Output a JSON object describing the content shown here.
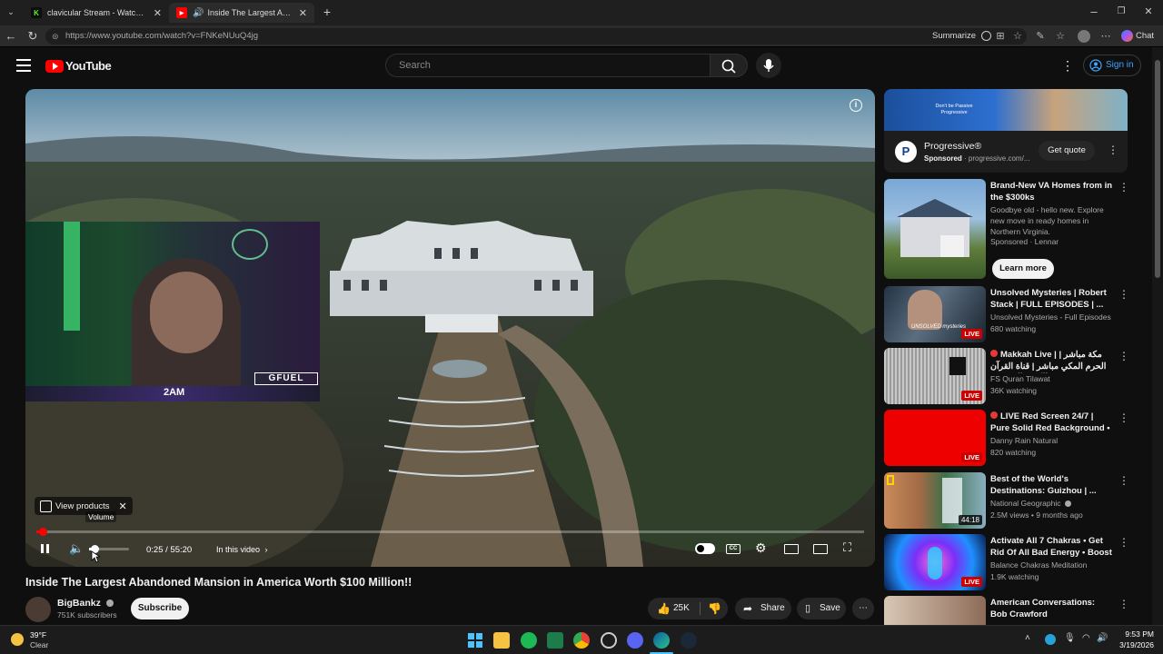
{
  "browser": {
    "tabs": [
      {
        "label": "clavicular Stream - Watch Live on Kick"
      },
      {
        "label": "Inside The Largest Abandoned Mansion"
      }
    ],
    "url": "https://www.youtube.com/watch?v=FNKeNUuQ4jg",
    "summarize_label": "Summarize",
    "chat_label": "Chat"
  },
  "header": {
    "logo": "YouTube",
    "search_placeholder": "Search",
    "signin_label": "Sign in"
  },
  "player": {
    "overlay_badge": "2AM",
    "overlay_brand": "GFUEL",
    "view_products_label": "View products",
    "volume_tooltip": "Volume",
    "time": "0:25 / 55:20",
    "in_this_video": "In this video",
    "progress_fraction": 0.0075
  },
  "video": {
    "title": "Inside The Largest Abandoned Mansion in America Worth $100 Million!!",
    "channel": "BigBankz",
    "subscribers": "751K subscribers",
    "subscribe_label": "Subscribe",
    "likes": "25K",
    "share_label": "Share",
    "save_label": "Save"
  },
  "ad": {
    "banner_text": "Don't be Passive Progressive",
    "name": "Progressive®",
    "sponsored": "Sponsored",
    "domain": "progressive.com/...",
    "cta": "Get quote"
  },
  "recommendations": [
    {
      "title": "Brand-New VA Homes from in the $300ks",
      "line1": "Goodbye old - hello new. Explore new move in ready homes in Northern Virginia.",
      "line2": "Sponsored · Lennar",
      "cta": "Learn more"
    },
    {
      "title": "Unsolved Mysteries | Robert Stack | FULL EPISODES | ...",
      "line1": "Unsolved Mysteries - Full Episodes",
      "line2": "680 watching",
      "badge": "LIVE",
      "thumb_text": "UNSOLVED mysteries"
    },
    {
      "title": "Makkah Live | مكة مباشر | الحرم المكي مباشر | قناة القرآن الكريم السعودية",
      "line1": "FS Quran Tilawat",
      "line2": "36K watching",
      "badge": "LIVE"
    },
    {
      "title": "LIVE Red Screen 24/7 | Pure Solid Red Background • ...",
      "line1": "Danny Rain Natural",
      "line2": "820 watching",
      "badge": "LIVE"
    },
    {
      "title": "Best of the World's Destinations: Guizhou | ...",
      "line1": "National Geographic",
      "line2": "2.5M views • 9 months ago",
      "duration": "44:18"
    },
    {
      "title": "Activate All 7 Chakras • Get Rid Of All Bad Energy • Boost ...",
      "line1": "Balance Chakras Meditation",
      "line2": "1.9K watching",
      "badge": "LIVE"
    },
    {
      "title": "American Conversations: Bob Crawford",
      "line1": "",
      "line2": ""
    }
  ],
  "taskbar": {
    "weather_temp": "39°F",
    "weather_desc": "Clear",
    "time": "9:53 PM",
    "date": "3/19/2026"
  },
  "colors": {
    "youtube_red": "#ff0000",
    "link_blue": "#3ea6ff",
    "background": "#0f0f0f",
    "live_red": "#cc0000"
  }
}
